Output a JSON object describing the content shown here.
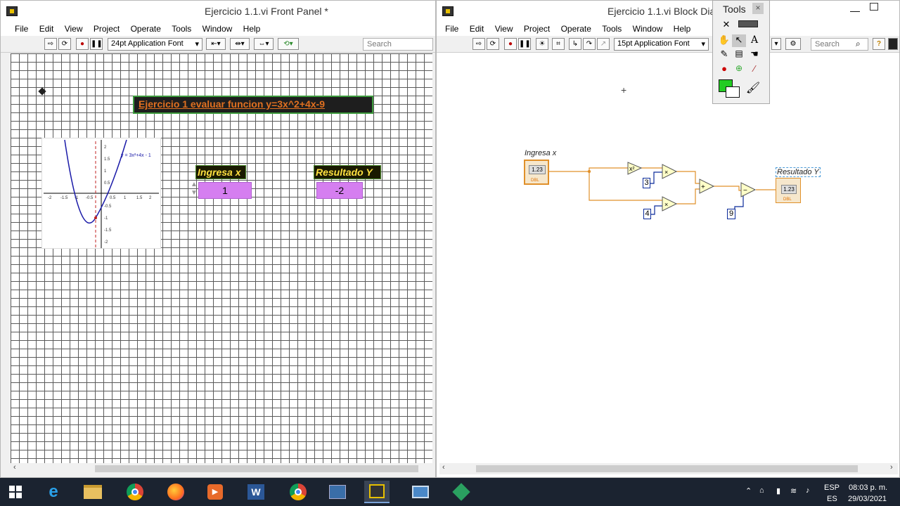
{
  "front_panel": {
    "title": "Ejercicio 1.1.vi Front Panel *",
    "menu": [
      "File",
      "Edit",
      "View",
      "Project",
      "Operate",
      "Tools",
      "Window",
      "Help"
    ],
    "font_label": "24pt Application Font",
    "search_placeholder": "Search",
    "heading": "Ejercicio 1 evaluar funcion y=3x^2+4x-9",
    "input_label": "Ingresa x",
    "input_value": "1",
    "output_label": "Resultado Y",
    "output_value": "-2",
    "graph_legend": "y = 3x²+4x - 1",
    "graph_xticks": [
      "-2",
      "-1.5",
      "-1",
      "-0.5",
      "0.5",
      "1",
      "1.5",
      "2"
    ],
    "graph_yticks": [
      "2",
      "1.5",
      "1",
      "0.5",
      "-0.5",
      "-1",
      "-1.5",
      "-2"
    ]
  },
  "block_diagram": {
    "title": "Ejercicio 1.1.vi Block Dia",
    "menu": [
      "File",
      "Edit",
      "View",
      "Project",
      "Operate",
      "Tools",
      "Window",
      "Help"
    ],
    "font_label": "15pt Application Font",
    "search_placeholder": "Search",
    "input_label": "Ingresa x",
    "output_label": "Resultado Y",
    "terminal_text": "1.23",
    "terminal_type": "DBL",
    "const_3": "3",
    "const_4": "4",
    "const_9": "9"
  },
  "tools_palette": {
    "title": "Tools",
    "close": "×"
  },
  "tray": {
    "lang1": "ESP",
    "lang2": "ES",
    "time": "08:03 p. m.",
    "date": "29/03/2021"
  },
  "colors": {
    "heading_bg": "#1e1e1e",
    "heading_text": "#e07020",
    "label_bg": "#1a1a00",
    "label_text": "#ffe040",
    "value_bg": "#d57ef0",
    "wire": "#e0902a",
    "const_blue": "#0a2a9a",
    "curve": "#1a1aa8",
    "axis_dash": "#c02020",
    "palette_green": "#22cc22"
  }
}
